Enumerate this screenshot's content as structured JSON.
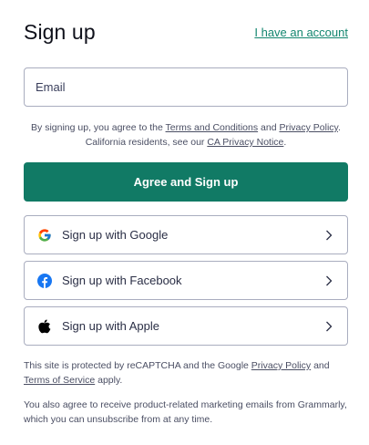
{
  "header": {
    "title": "Sign up",
    "account_link": "I have an account"
  },
  "form": {
    "email_placeholder": "Email"
  },
  "terms": {
    "prefix": "By signing up, you agree to the ",
    "terms_link": "Terms and Conditions",
    "and": " and ",
    "privacy_link": "Privacy Policy",
    "period": ".",
    "ca_prefix": "California residents, see our ",
    "ca_link": "CA Privacy Notice",
    "ca_suffix": "."
  },
  "primary_button": {
    "label": "Agree and Sign up"
  },
  "social": [
    {
      "label": "Sign up with Google",
      "icon": "google-icon"
    },
    {
      "label": "Sign up with Facebook",
      "icon": "facebook-icon"
    },
    {
      "label": "Sign up with Apple",
      "icon": "apple-icon"
    }
  ],
  "recaptcha": {
    "prefix": "This site is protected by reCAPTCHA and the Google ",
    "privacy_link": "Privacy Policy",
    "and": " and ",
    "tos_link": "Terms of Service",
    "suffix": " apply."
  },
  "marketing": {
    "text": "You also agree to receive product-related marketing emails from Grammarly, which you can unsubscribe from at any time."
  },
  "colors": {
    "accent": "#117a65",
    "link": "#13866f",
    "border": "#a9adbf",
    "facebook": "#1877f2"
  }
}
